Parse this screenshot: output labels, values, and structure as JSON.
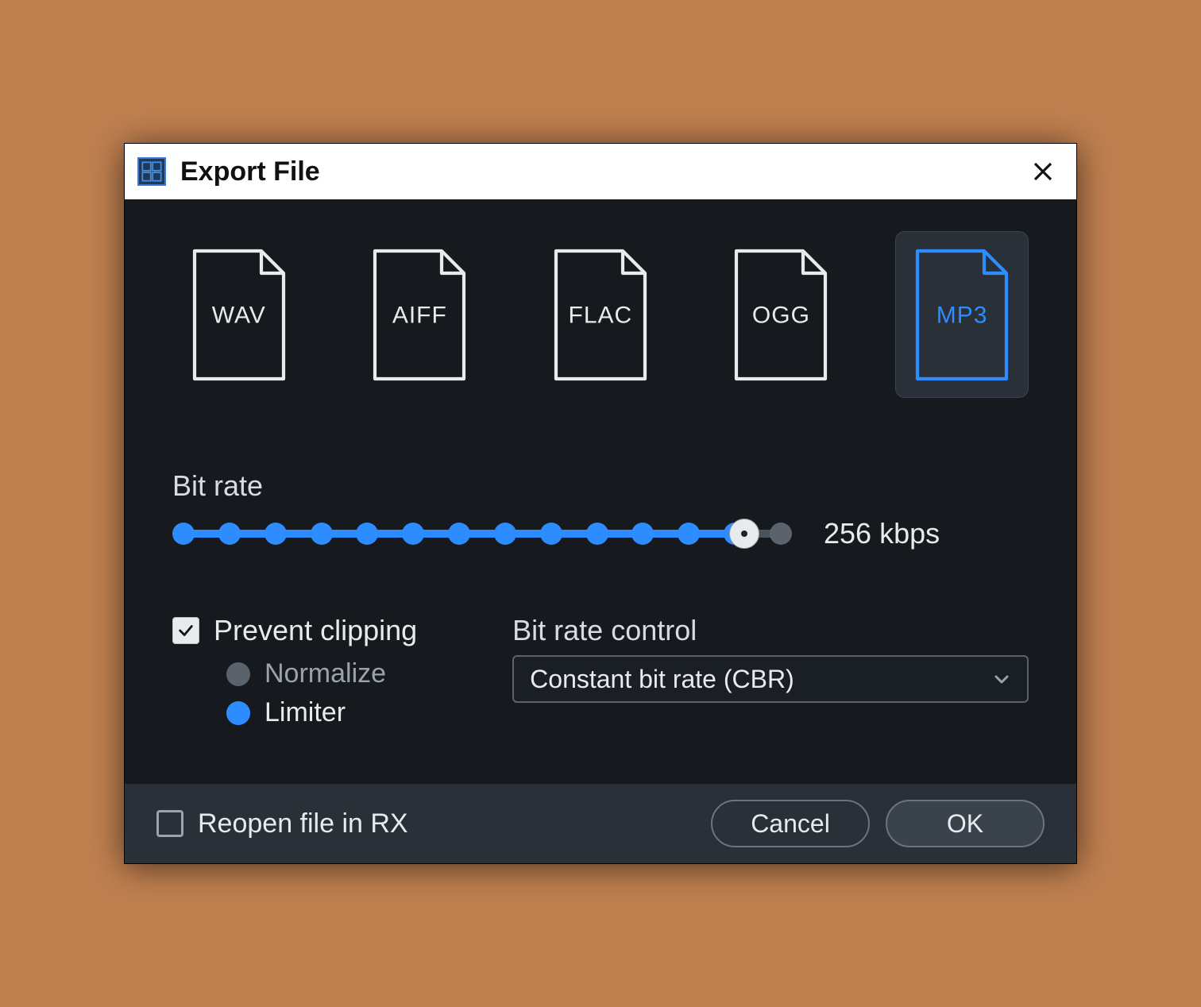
{
  "dialog": {
    "title": "Export File"
  },
  "formats": [
    {
      "label": "WAV",
      "selected": false
    },
    {
      "label": "AIFF",
      "selected": false
    },
    {
      "label": "FLAC",
      "selected": false
    },
    {
      "label": "OGG",
      "selected": false
    },
    {
      "label": "MP3",
      "selected": true
    }
  ],
  "bitrate": {
    "label": "Bit rate",
    "value_text": "256 kbps",
    "value": 256,
    "steps": 14,
    "active_step_index": 12
  },
  "prevent_clipping": {
    "label": "Prevent clipping",
    "checked": true,
    "options": {
      "normalize": {
        "label": "Normalize",
        "selected": false
      },
      "limiter": {
        "label": "Limiter",
        "selected": true
      }
    }
  },
  "bitrate_control": {
    "label": "Bit rate control",
    "selected": "Constant bit rate (CBR)"
  },
  "footer": {
    "reopen": {
      "label": "Reopen file in RX",
      "checked": false
    },
    "cancel": "Cancel",
    "ok": "OK"
  },
  "colors": {
    "accent": "#2d8cff",
    "panel_bg": "#161a1f",
    "footer_bg": "#2a3038"
  }
}
